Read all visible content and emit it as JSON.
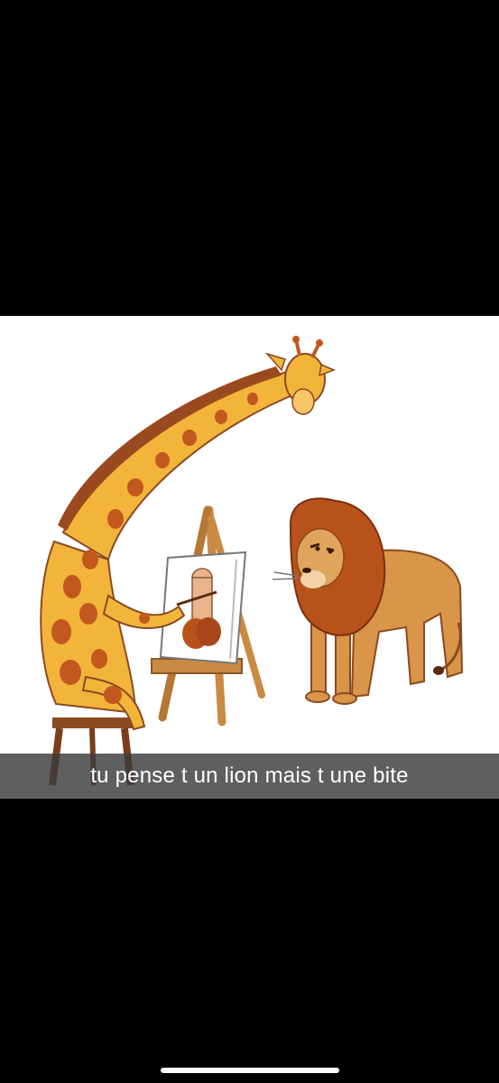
{
  "snap": {
    "caption": "tu pense t un lion mais t une bite"
  },
  "colors": {
    "background": "#000000",
    "photo_background": "#ffffff",
    "caption_bar": "#3c3c3c",
    "caption_text": "#ffffff",
    "giraffe_body": "#f3b43a",
    "giraffe_spots": "#c2581e",
    "lion_body": "#d99548",
    "lion_mane": "#b9511b",
    "easel_wood": "#c98a43"
  },
  "icons": {
    "home_indicator": "home-indicator-bar"
  }
}
